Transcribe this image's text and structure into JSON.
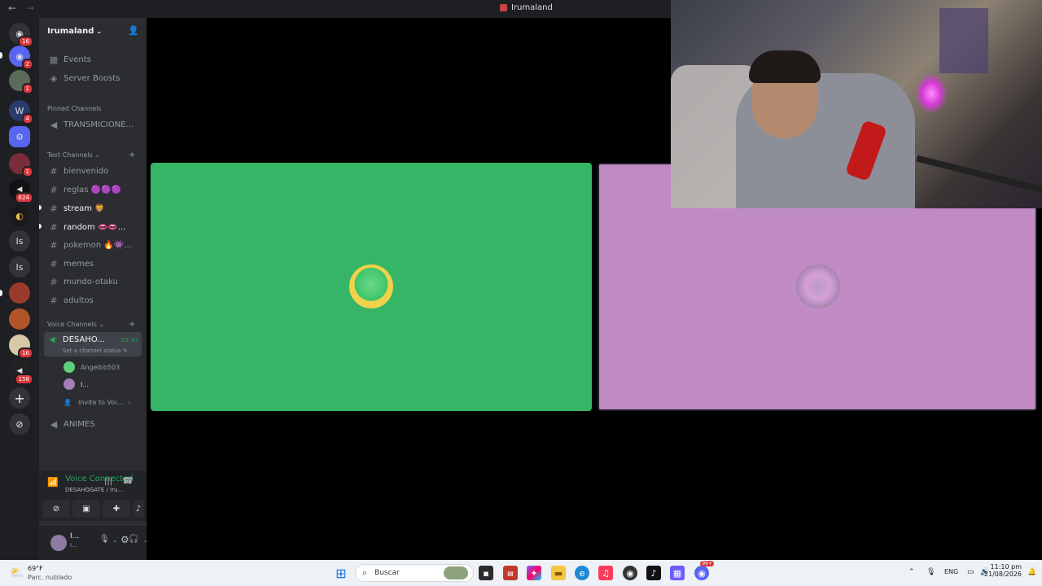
{
  "window": {
    "title": "Irumaland",
    "back": "←",
    "forward": "→"
  },
  "guilds": [
    {
      "label": "",
      "badge": "16"
    },
    {
      "label": "",
      "badge": "2"
    },
    {
      "label": "",
      "badge": "1"
    },
    {
      "label": "",
      "badge": "4"
    },
    {
      "label": "",
      "badge": ""
    },
    {
      "label": "",
      "badge": "1"
    },
    {
      "label": "",
      "badge": "624"
    },
    {
      "label": "",
      "badge": ""
    },
    {
      "label": "Is",
      "badge": ""
    },
    {
      "label": "Is",
      "badge": ""
    },
    {
      "label": "",
      "badge": ""
    },
    {
      "label": "",
      "badge": ""
    },
    {
      "label": "",
      "badge": "16"
    },
    {
      "label": "",
      "badge": "158"
    }
  ],
  "server": {
    "name": "Irumaland"
  },
  "menu": {
    "events": "Events",
    "boosts": "Server Boosts"
  },
  "pinned": {
    "title": "Pinned Channels",
    "channel": "TRANSMICIONE..."
  },
  "text_channels": {
    "title": "Text Channels",
    "items": [
      {
        "name": "bienvenido"
      },
      {
        "name": "reglas 🟣🟣🟣"
      },
      {
        "name": "stream 🦁"
      },
      {
        "name": "random 👄👄..."
      },
      {
        "name": "pokemon 🔥👾..."
      },
      {
        "name": "memes"
      },
      {
        "name": "mundo-otaku"
      },
      {
        "name": "adultos"
      }
    ]
  },
  "voice_channels": {
    "title": "Voice Channels",
    "active": {
      "name": "DESAHO...",
      "time": "53:07",
      "status": "Set a channel status ✎"
    },
    "users": [
      "Angelbb503",
      "I..."
    ],
    "invite": "Invite to Voi...",
    "other": "ANIMES"
  },
  "voice_panel": {
    "status": "Voice Connected",
    "channel": "DESAHOGATE / Iru..."
  },
  "user_panel": {
    "name": "I...",
    "status": "I..."
  },
  "tiles": [
    {
      "color": "#36b566",
      "avatar_color": "#5fd07a"
    },
    {
      "color": "#c08bc4",
      "avatar_color": "#a27fb6"
    }
  ],
  "taskbar": {
    "temp": "69°F",
    "weather": "Parc. nublado",
    "search_placeholder": "Buscar",
    "lang": "ENG",
    "time": "11:10 pm",
    "date": "21/08/2026",
    "discord_badge": "99+"
  },
  "colors": {
    "accent_green": "#23a55a",
    "badge_red": "#da373c",
    "sidebar": "#2b2d31"
  }
}
